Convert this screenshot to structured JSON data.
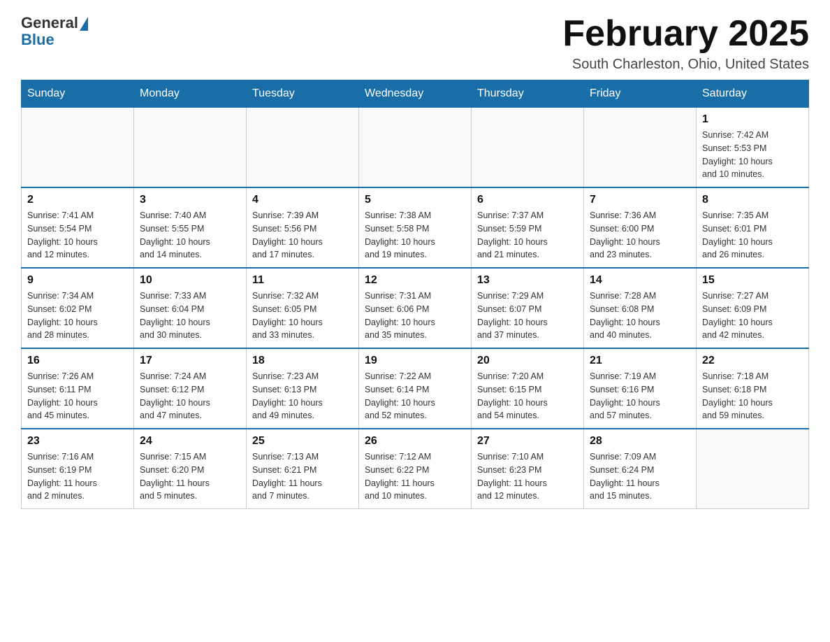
{
  "logo": {
    "general": "General",
    "blue": "Blue"
  },
  "title": "February 2025",
  "location": "South Charleston, Ohio, United States",
  "days_of_week": [
    "Sunday",
    "Monday",
    "Tuesday",
    "Wednesday",
    "Thursday",
    "Friday",
    "Saturday"
  ],
  "weeks": [
    [
      {
        "day": "",
        "info": ""
      },
      {
        "day": "",
        "info": ""
      },
      {
        "day": "",
        "info": ""
      },
      {
        "day": "",
        "info": ""
      },
      {
        "day": "",
        "info": ""
      },
      {
        "day": "",
        "info": ""
      },
      {
        "day": "1",
        "info": "Sunrise: 7:42 AM\nSunset: 5:53 PM\nDaylight: 10 hours\nand 10 minutes."
      }
    ],
    [
      {
        "day": "2",
        "info": "Sunrise: 7:41 AM\nSunset: 5:54 PM\nDaylight: 10 hours\nand 12 minutes."
      },
      {
        "day": "3",
        "info": "Sunrise: 7:40 AM\nSunset: 5:55 PM\nDaylight: 10 hours\nand 14 minutes."
      },
      {
        "day": "4",
        "info": "Sunrise: 7:39 AM\nSunset: 5:56 PM\nDaylight: 10 hours\nand 17 minutes."
      },
      {
        "day": "5",
        "info": "Sunrise: 7:38 AM\nSunset: 5:58 PM\nDaylight: 10 hours\nand 19 minutes."
      },
      {
        "day": "6",
        "info": "Sunrise: 7:37 AM\nSunset: 5:59 PM\nDaylight: 10 hours\nand 21 minutes."
      },
      {
        "day": "7",
        "info": "Sunrise: 7:36 AM\nSunset: 6:00 PM\nDaylight: 10 hours\nand 23 minutes."
      },
      {
        "day": "8",
        "info": "Sunrise: 7:35 AM\nSunset: 6:01 PM\nDaylight: 10 hours\nand 26 minutes."
      }
    ],
    [
      {
        "day": "9",
        "info": "Sunrise: 7:34 AM\nSunset: 6:02 PM\nDaylight: 10 hours\nand 28 minutes."
      },
      {
        "day": "10",
        "info": "Sunrise: 7:33 AM\nSunset: 6:04 PM\nDaylight: 10 hours\nand 30 minutes."
      },
      {
        "day": "11",
        "info": "Sunrise: 7:32 AM\nSunset: 6:05 PM\nDaylight: 10 hours\nand 33 minutes."
      },
      {
        "day": "12",
        "info": "Sunrise: 7:31 AM\nSunset: 6:06 PM\nDaylight: 10 hours\nand 35 minutes."
      },
      {
        "day": "13",
        "info": "Sunrise: 7:29 AM\nSunset: 6:07 PM\nDaylight: 10 hours\nand 37 minutes."
      },
      {
        "day": "14",
        "info": "Sunrise: 7:28 AM\nSunset: 6:08 PM\nDaylight: 10 hours\nand 40 minutes."
      },
      {
        "day": "15",
        "info": "Sunrise: 7:27 AM\nSunset: 6:09 PM\nDaylight: 10 hours\nand 42 minutes."
      }
    ],
    [
      {
        "day": "16",
        "info": "Sunrise: 7:26 AM\nSunset: 6:11 PM\nDaylight: 10 hours\nand 45 minutes."
      },
      {
        "day": "17",
        "info": "Sunrise: 7:24 AM\nSunset: 6:12 PM\nDaylight: 10 hours\nand 47 minutes."
      },
      {
        "day": "18",
        "info": "Sunrise: 7:23 AM\nSunset: 6:13 PM\nDaylight: 10 hours\nand 49 minutes."
      },
      {
        "day": "19",
        "info": "Sunrise: 7:22 AM\nSunset: 6:14 PM\nDaylight: 10 hours\nand 52 minutes."
      },
      {
        "day": "20",
        "info": "Sunrise: 7:20 AM\nSunset: 6:15 PM\nDaylight: 10 hours\nand 54 minutes."
      },
      {
        "day": "21",
        "info": "Sunrise: 7:19 AM\nSunset: 6:16 PM\nDaylight: 10 hours\nand 57 minutes."
      },
      {
        "day": "22",
        "info": "Sunrise: 7:18 AM\nSunset: 6:18 PM\nDaylight: 10 hours\nand 59 minutes."
      }
    ],
    [
      {
        "day": "23",
        "info": "Sunrise: 7:16 AM\nSunset: 6:19 PM\nDaylight: 11 hours\nand 2 minutes."
      },
      {
        "day": "24",
        "info": "Sunrise: 7:15 AM\nSunset: 6:20 PM\nDaylight: 11 hours\nand 5 minutes."
      },
      {
        "day": "25",
        "info": "Sunrise: 7:13 AM\nSunset: 6:21 PM\nDaylight: 11 hours\nand 7 minutes."
      },
      {
        "day": "26",
        "info": "Sunrise: 7:12 AM\nSunset: 6:22 PM\nDaylight: 11 hours\nand 10 minutes."
      },
      {
        "day": "27",
        "info": "Sunrise: 7:10 AM\nSunset: 6:23 PM\nDaylight: 11 hours\nand 12 minutes."
      },
      {
        "day": "28",
        "info": "Sunrise: 7:09 AM\nSunset: 6:24 PM\nDaylight: 11 hours\nand 15 minutes."
      },
      {
        "day": "",
        "info": ""
      }
    ]
  ]
}
